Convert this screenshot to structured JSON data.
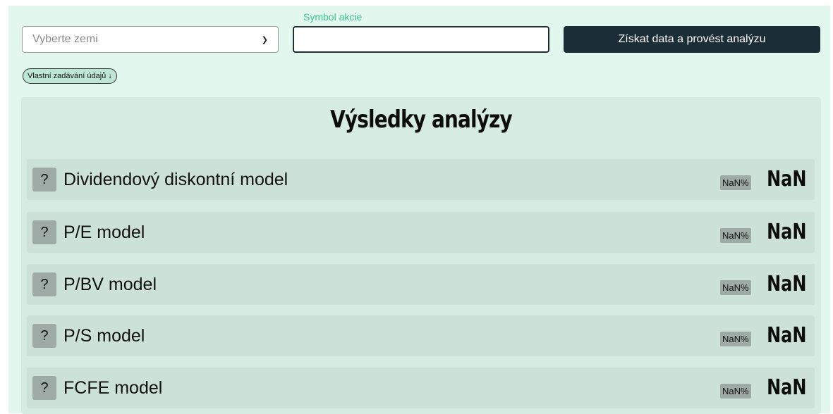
{
  "form": {
    "country_placeholder": "Vyberte zemi",
    "symbol_label": "Symbol akcie",
    "symbol_value": "",
    "analyze_button": "Získat data a provést analýzu",
    "custom_input_toggle": "Vlastní zadávání údajů",
    "custom_input_icon": "arrow-down-icon"
  },
  "results": {
    "title": "Výsledky analýzy",
    "models": [
      {
        "help": "?",
        "name": "Dividendový diskontní model",
        "pct": "NaN%",
        "value": "NaN"
      },
      {
        "help": "?",
        "name": "P/E model",
        "pct": "NaN%",
        "value": "NaN"
      },
      {
        "help": "?",
        "name": "P/BV model",
        "pct": "NaN%",
        "value": "NaN"
      },
      {
        "help": "?",
        "name": "P/S model",
        "pct": "NaN%",
        "value": "NaN"
      },
      {
        "help": "?",
        "name": "FCFE model",
        "pct": "NaN%",
        "value": "NaN"
      }
    ]
  },
  "colors": {
    "page_bg": "#e2f7ee",
    "accent_label": "#3fc48d",
    "button_bg": "#1b2e38",
    "panel_bg": "#d6ebe1",
    "row_bg": "#cce2d8",
    "badge_bg": "#9eaaa6"
  }
}
